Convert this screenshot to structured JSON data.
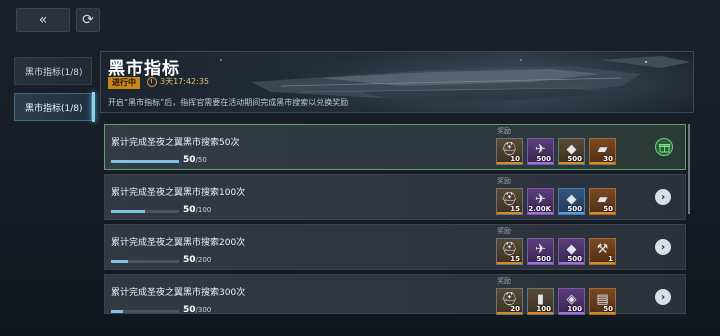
{
  "nav": {
    "back_glyph": "«",
    "refresh_glyph": "⟳"
  },
  "sidebar": {
    "items": [
      {
        "label": "黑市指标(1/8)",
        "selected": false
      },
      {
        "label": "黑市指标(1/8)",
        "selected": true
      }
    ]
  },
  "banner": {
    "title": "黑市指标",
    "status": "进行中",
    "timer": "3天17:42:35",
    "description": "开启“黑市指标”后，指挥官需要在活动期间完成黑市搜索以兑换奖励"
  },
  "reward_label": "奖励",
  "tasks": [
    {
      "title": "累计完成圣夜之翼黑市搜索50次",
      "progress_current": "50",
      "progress_total": "/50",
      "progress_fraction": 1.0,
      "completed": true,
      "rewards": [
        {
          "icon": "helmet-icon",
          "qty": "10",
          "tier": "gold"
        },
        {
          "icon": "pistol-icon",
          "qty": "500",
          "tier": "purple"
        },
        {
          "icon": "ore-icon",
          "qty": "500",
          "tier": "gold"
        },
        {
          "icon": "crate-icon",
          "qty": "30",
          "tier": "orange"
        }
      ],
      "action": "gift-icon"
    },
    {
      "title": "累计完成圣夜之翼黑市搜索100次",
      "progress_current": "50",
      "progress_total": "/100",
      "progress_fraction": 0.5,
      "completed": false,
      "rewards": [
        {
          "icon": "helmet-icon",
          "qty": "15",
          "tier": "gold"
        },
        {
          "icon": "drone-icon",
          "qty": "2.00K",
          "tier": "purple"
        },
        {
          "icon": "ore-icon",
          "qty": "500",
          "tier": "blue"
        },
        {
          "icon": "crate-icon",
          "qty": "50",
          "tier": "orange"
        }
      ],
      "action": "chevron-right-icon"
    },
    {
      "title": "累计完成圣夜之翼黑市搜索200次",
      "progress_current": "50",
      "progress_total": "/200",
      "progress_fraction": 0.25,
      "completed": false,
      "rewards": [
        {
          "icon": "helmet-icon",
          "qty": "15",
          "tier": "gold"
        },
        {
          "icon": "pistol-icon",
          "qty": "500",
          "tier": "purple"
        },
        {
          "icon": "ore-icon",
          "qty": "500",
          "tier": "purple"
        },
        {
          "icon": "cannon-icon",
          "qty": "1",
          "tier": "orange"
        }
      ],
      "action": "chevron-right-icon"
    },
    {
      "title": "累计完成圣夜之翼黑市搜索300次",
      "progress_current": "50",
      "progress_total": "/300",
      "progress_fraction": 0.17,
      "completed": false,
      "rewards": [
        {
          "icon": "helmet-icon",
          "qty": "20",
          "tier": "gold"
        },
        {
          "icon": "barrel-icon",
          "qty": "100",
          "tier": "gold"
        },
        {
          "icon": "crystal-icon",
          "qty": "100",
          "tier": "purple"
        },
        {
          "icon": "module-icon",
          "qty": "50",
          "tier": "orange"
        }
      ],
      "action": "chevron-right-icon"
    }
  ]
}
